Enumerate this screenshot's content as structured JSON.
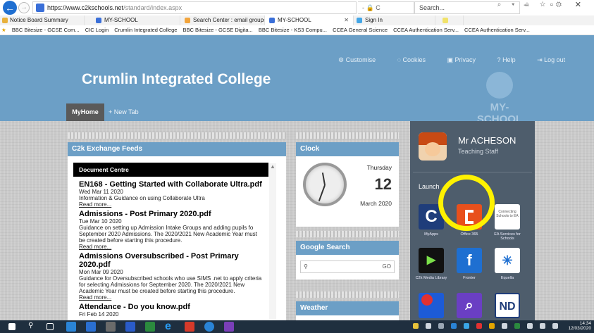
{
  "browser": {
    "url_host": "https://www.c2kschools.net",
    "url_path": "/standard/index.aspx",
    "address_icons": "- 🔒 C",
    "search_placeholder": "Search...",
    "window_controls": "– ▫ ✕",
    "top_icons": "⌕ ▾ ⌂ ☆ ⚙"
  },
  "tabs": [
    {
      "label": "Notice Board Summary",
      "color": "#e8b13c"
    },
    {
      "label": "MY-SCHOOL",
      "color": "#3a6fd8"
    },
    {
      "label": "Search Center : email groups",
      "color": "#f2a43c"
    },
    {
      "label": "MY-SCHOOL",
      "color": "#3a6fd8",
      "close": "✕"
    },
    {
      "label": "Sign In",
      "color": "#44a6e6"
    },
    {
      "label": "",
      "color": "#f1e26a"
    }
  ],
  "favorites": [
    "BBC Bitesize - GCSE Com...",
    "CIC Login",
    "Crumlin Integrated College",
    "BBC Bitesize - GCSE Digita...",
    "BBC Bitesize - KS3 Compu...",
    "CCEA General Science",
    "CCEA Authentication Serv...",
    "CCEA Authentication Serv..."
  ],
  "header": {
    "links": [
      "Customise",
      "Cookies",
      "Privacy",
      "Help",
      "Log out"
    ],
    "college_name": "Crumlin Integrated College",
    "logo_text": "MY-SCHOOL",
    "tab_home": "MyHome",
    "tab_new": "+ New Tab"
  },
  "feeds": {
    "title": "C2k Exchange Feeds",
    "section": "Document Centre",
    "items": [
      {
        "title": "EN168 - Getting Started with Collaborate Ultra.pdf",
        "date": "Wed Mar 11 2020",
        "desc": "Information & Guidance on using Collaborate Ultra",
        "link": "Read more..."
      },
      {
        "title": "Admissions - Post Primary 2020.pdf",
        "date": "Tue Mar 10 2020",
        "desc": "Guidance on setting up Admission Intake Groups and adding pupils fo September 2020 Admissions. The 2020/2021 New Academic Year must be created before starting this procedure.",
        "link": "Read more..."
      },
      {
        "title": "Admissions Oversubscribed - Post Primary 2020.pdf",
        "date": "Mon Mar 09 2020",
        "desc": "Guidance for Oversubscribed schools who use SIMS .net to apply criteria for selecting Admissions for September 2020. The 2020/2021 New Academic Year must be created before starting this procedure.",
        "link": "Read more..."
      },
      {
        "title": "Attendance - Do you know.pdf",
        "date": "Fri Feb 14 2020",
        "desc": "",
        "link": ""
      }
    ]
  },
  "clock": {
    "title": "Clock",
    "day": "Thursday",
    "date": "12",
    "month": "March 2020"
  },
  "google_search": {
    "title": "Google Search",
    "go": "GO"
  },
  "weather": {
    "title": "Weather"
  },
  "user": {
    "name": "Mr ACHESON",
    "role": "Teaching Staff"
  },
  "launch": {
    "title": "Launch",
    "apps": [
      {
        "label": "MyApps",
        "color": "#1f3d7a",
        "glyph": "C"
      },
      {
        "label": "Office 365",
        "color": "#e8501c",
        "glyph": ""
      },
      {
        "label": "EA Services for Schools",
        "color": "#ffffff",
        "glyph": "Connecting Schools to EA"
      },
      {
        "label": "C2k Media Library",
        "color": "#111111",
        "glyph": "▶"
      },
      {
        "label": "Fronter",
        "color": "#1e6fd1",
        "glyph": "f"
      },
      {
        "label": "Equella",
        "color": "#ffffff",
        "glyph": "✳"
      },
      {
        "label": "",
        "color": "#1d5bd6",
        "glyph": ""
      },
      {
        "label": "",
        "color": "#6a3fc3",
        "glyph": "⌕"
      },
      {
        "label": "",
        "color": "#ffffff",
        "glyph": "ND"
      }
    ]
  },
  "taskbar": {
    "time": "14:34",
    "date": "12/03/2020"
  }
}
